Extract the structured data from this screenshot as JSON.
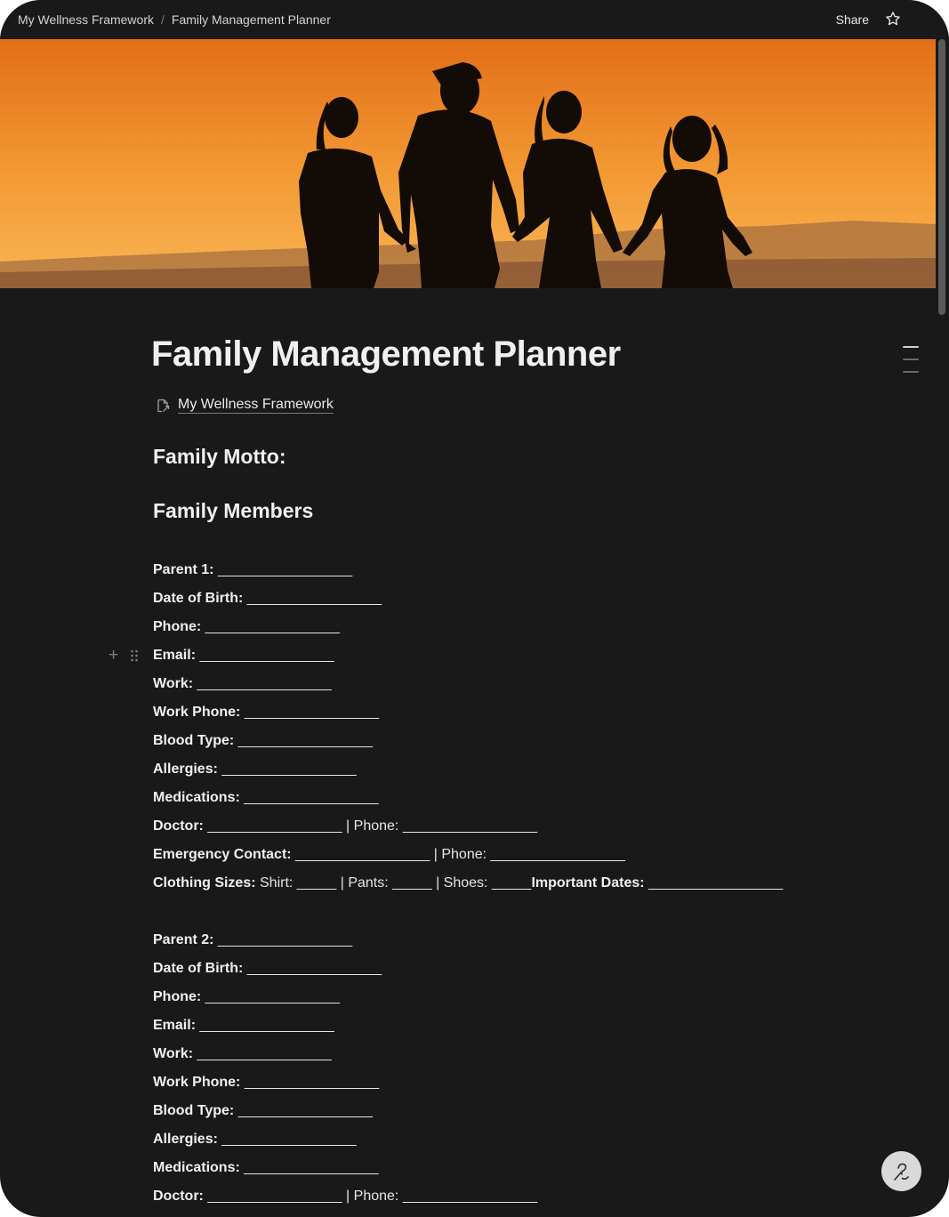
{
  "topbar": {
    "breadcrumb": [
      "My Wellness Framework",
      "Family Management Planner"
    ],
    "separator": "/",
    "share_label": "Share"
  },
  "page": {
    "title": "Family Management Planner",
    "parent_link": "My Wellness Framework",
    "headings": {
      "motto": "Family Motto:",
      "members": "Family Members"
    }
  },
  "parent1": [
    {
      "label": "Parent 1:",
      "rest": " _________________"
    },
    {
      "label": "Date of Birth:",
      "rest": " _________________"
    },
    {
      "label": "Phone:",
      "rest": " _________________"
    },
    {
      "label": "Email:",
      "rest": " _________________"
    },
    {
      "label": "Work:",
      "rest": " _________________"
    },
    {
      "label": "Work Phone:",
      "rest": " _________________"
    },
    {
      "label": "Blood Type:",
      "rest": " _________________"
    },
    {
      "label": "Allergies:",
      "rest": " _________________"
    },
    {
      "label": "Medications:",
      "rest": " _________________"
    },
    {
      "label": "Doctor:",
      "rest": " _________________ | Phone: _________________"
    },
    {
      "label": "Emergency Contact:",
      "rest": " _________________ | Phone: _________________"
    },
    {
      "label": "Clothing Sizes:",
      "rest": " Shirt: _____ | Pants: _____ | Shoes: _____",
      "label2": "Important Dates:",
      "rest2": " _________________"
    }
  ],
  "parent2": [
    {
      "label": "Parent 2:",
      "rest": " _________________"
    },
    {
      "label": "Date of Birth:",
      "rest": " _________________"
    },
    {
      "label": "Phone:",
      "rest": " _________________"
    },
    {
      "label": "Email:",
      "rest": " _________________"
    },
    {
      "label": "Work:",
      "rest": " _________________"
    },
    {
      "label": "Work Phone:",
      "rest": " _________________"
    },
    {
      "label": "Blood Type:",
      "rest": " _________________"
    },
    {
      "label": "Allergies:",
      "rest": " _________________"
    },
    {
      "label": "Medications:",
      "rest": " _________________"
    },
    {
      "label": "Doctor:",
      "rest": " _________________ | Phone: _________________"
    }
  ],
  "icons": {
    "star": "star-icon",
    "page_link": "page-link-icon",
    "toc": "table-of-contents-icon",
    "add_block": "plus-icon",
    "drag_handle": "drag-handle-icon",
    "help": "help-icon"
  },
  "colors": {
    "background": "#191919",
    "text": "#f0f0f0",
    "cover_sky_top": "#e3761c",
    "cover_sky_bottom": "#f7b24a",
    "help_button": "#d9d9d9"
  }
}
